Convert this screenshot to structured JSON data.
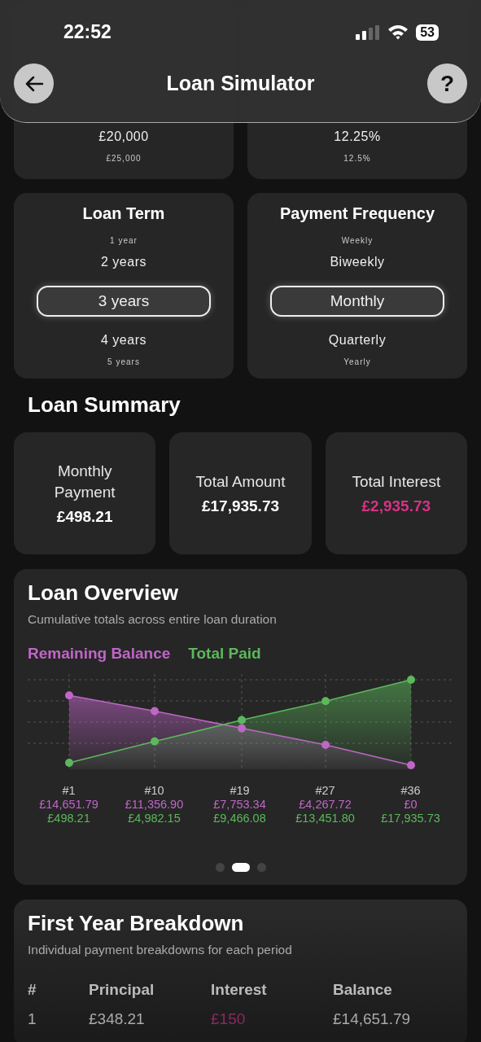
{
  "status_bar": {
    "time": "22:52",
    "battery": "53"
  },
  "header": {
    "title": "Loan Simulator",
    "help": "?"
  },
  "top_pickers": [
    {
      "items": [
        "£20,000",
        "£25,000"
      ]
    },
    {
      "items": [
        "12.25%",
        "12.5%"
      ]
    }
  ],
  "pickers": [
    {
      "title": "Loan Term",
      "options": [
        {
          "label": "1 year",
          "selected": false
        },
        {
          "label": "2 years",
          "selected": false
        },
        {
          "label": "3 years",
          "selected": true
        },
        {
          "label": "4 years",
          "selected": false
        },
        {
          "label": "5 years",
          "selected": false
        }
      ]
    },
    {
      "title": "Payment Frequency",
      "options": [
        {
          "label": "Weekly",
          "selected": false
        },
        {
          "label": "Biweekly",
          "selected": false
        },
        {
          "label": "Monthly",
          "selected": true
        },
        {
          "label": "Quarterly",
          "selected": false
        },
        {
          "label": "Yearly",
          "selected": false
        }
      ]
    }
  ],
  "summary": {
    "title": "Loan Summary",
    "cards": [
      {
        "label": "Monthly Payment",
        "value": "£498.21",
        "kind": "plain"
      },
      {
        "label": "Total Amount",
        "value": "£17,935.73",
        "kind": "plain"
      },
      {
        "label": "Total Interest",
        "value": "£2,935.73",
        "kind": "interest"
      }
    ]
  },
  "overview": {
    "title": "Loan Overview",
    "subtitle": "Cumulative totals across entire loan duration",
    "chart_data": {
      "type": "area",
      "categories": [
        "#1",
        "#10",
        "#19",
        "#27",
        "#36"
      ],
      "grid": true,
      "series": [
        {
          "name": "Remaining Balance",
          "color": "#c066c8",
          "values": [
            14651.79,
            11356.9,
            7753.34,
            4267.72,
            0
          ],
          "value_labels": [
            "£14,651.79",
            "£11,356.90",
            "£7,753.34",
            "£4,267.72",
            "£0"
          ]
        },
        {
          "name": "Total Paid",
          "color": "#5cb85c",
          "values": [
            498.21,
            4982.15,
            9466.08,
            13451.8,
            17935.73
          ],
          "value_labels": [
            "£498.21",
            "£4,982.15",
            "£9,466.08",
            "£13,451.80",
            "£17,935.73"
          ]
        }
      ]
    },
    "pager": [
      {
        "selected": false
      },
      {
        "selected": true
      },
      {
        "selected": false
      }
    ]
  },
  "breakdown": {
    "title": "First Year Breakdown",
    "subtitle": "Individual payment breakdowns for each period",
    "columns": [
      "#",
      "Principal",
      "Interest",
      "Balance"
    ],
    "rows": [
      [
        "1",
        "£348.21",
        "£150",
        "£14,651.79"
      ]
    ]
  }
}
